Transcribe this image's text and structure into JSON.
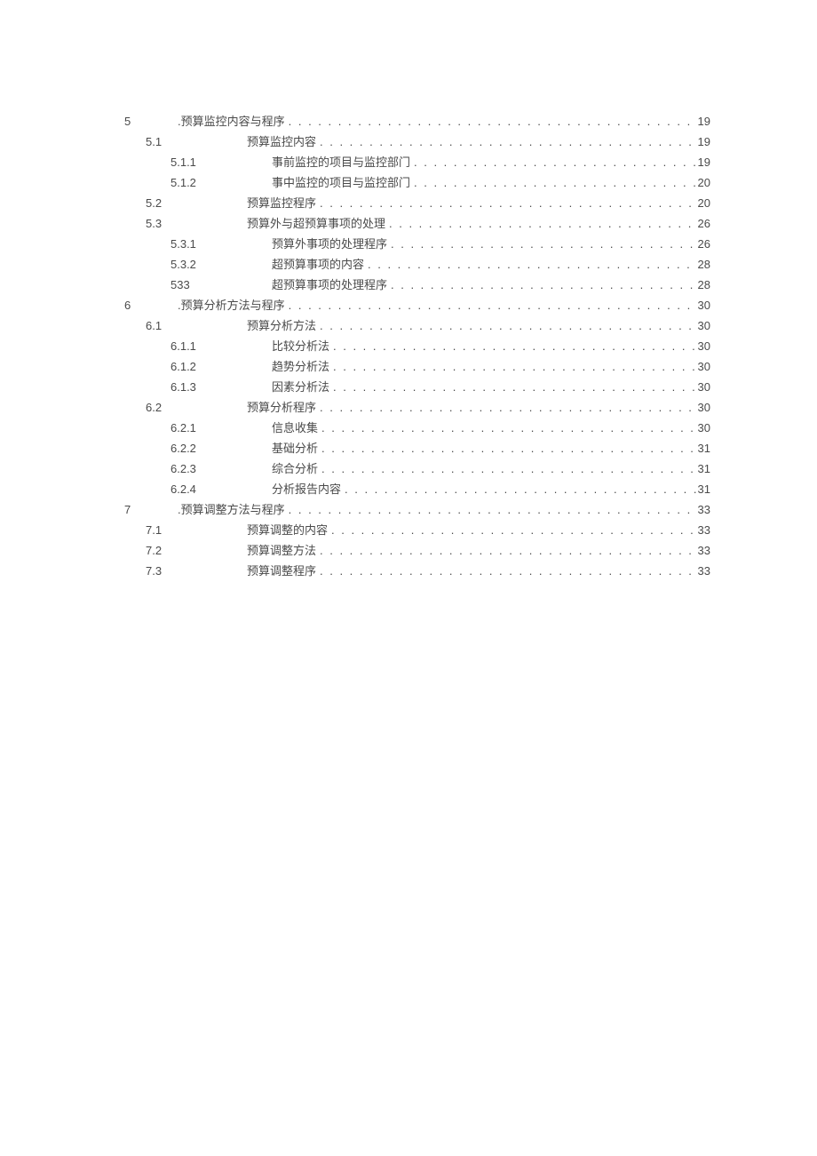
{
  "toc": {
    "entries": [
      {
        "level": 1,
        "num": "5",
        "title": ".预算监控内容与程序",
        "page": "19"
      },
      {
        "level": 2,
        "num": "5.1",
        "title": "预算监控内容",
        "page": "19"
      },
      {
        "level": 3,
        "num": "5.1.1",
        "title": "事前监控的项目与监控部门",
        "page": "19"
      },
      {
        "level": 3,
        "num": "5.1.2",
        "title": "事中监控的项目与监控部门",
        "page": "20"
      },
      {
        "level": 2,
        "num": "5.2",
        "title": "预算监控程序",
        "page": "20"
      },
      {
        "level": 2,
        "num": "5.3",
        "title": "预算外与超预算事项的处理",
        "page": "26"
      },
      {
        "level": 3,
        "num": "5.3.1",
        "title": "预算外事项的处理程序",
        "page": "26"
      },
      {
        "level": 3,
        "num": "5.3.2",
        "title": "超预算事项的内容",
        "page": "28"
      },
      {
        "level": 3,
        "num": "533",
        "title": "超预算事项的处理程序",
        "page": "28"
      },
      {
        "level": 1,
        "num": "6",
        "title": ".预算分析方法与程序",
        "page": "30"
      },
      {
        "level": 2,
        "num": "6.1",
        "title": "预算分析方法",
        "page": "30"
      },
      {
        "level": 3,
        "num": "6.1.1",
        "title": "比较分析法",
        "page": "30"
      },
      {
        "level": 3,
        "num": "6.1.2",
        "title": "趋势分析法",
        "page": "30"
      },
      {
        "level": 3,
        "num": "6.1.3",
        "title": "因素分析法",
        "page": "30"
      },
      {
        "level": 2,
        "num": "6.2",
        "title": "预算分析程序",
        "page": "30"
      },
      {
        "level": 3,
        "num": "6.2.1",
        "title": "信息收集",
        "page": "30"
      },
      {
        "level": 3,
        "num": "6.2.2",
        "title": "基础分析",
        "page": "31"
      },
      {
        "level": 3,
        "num": "6.2.3",
        "title": "综合分析",
        "page": "31"
      },
      {
        "level": 3,
        "num": "6.2.4",
        "title": "分析报告内容",
        "page": "31"
      },
      {
        "level": 1,
        "num": "7",
        "title": ".预算调整方法与程序",
        "page": "33"
      },
      {
        "level": 2,
        "num": "7.1",
        "title": "预算调整的内容",
        "page": "33"
      },
      {
        "level": 2,
        "num": "7.2",
        "title": "预算调整方法",
        "page": "33"
      },
      {
        "level": 2,
        "num": "7.3",
        "title": "预算调整程序",
        "page": "33"
      }
    ]
  }
}
